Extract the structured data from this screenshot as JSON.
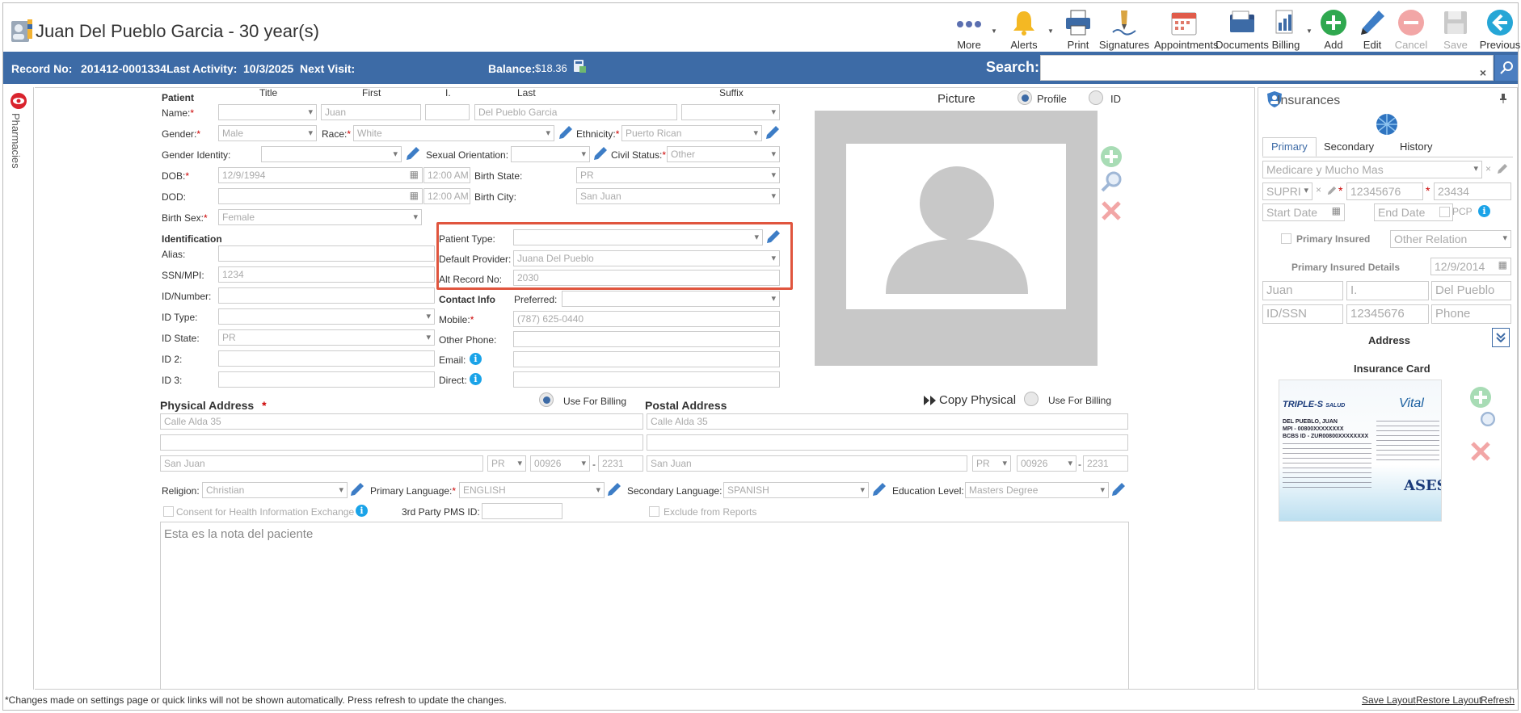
{
  "header": {
    "patient_title": "Juan Del Pueblo Garcia - 30 year(s)",
    "toolbar": {
      "more": "More",
      "alerts": "Alerts",
      "print": "Print",
      "signatures": "Signatures",
      "appointments": "Appointments",
      "documents": "Documents",
      "billing": "Billing",
      "add": "Add",
      "edit": "Edit",
      "cancel": "Cancel",
      "save": "Save",
      "previous": "Previous"
    }
  },
  "infobar": {
    "record_label": "Record No:",
    "record_value": "201412-0001334",
    "activity_label": "Last Activity:",
    "activity_value": "10/3/2025",
    "next_visit_label": "Next Visit:",
    "balance_label": "Balance:",
    "balance_value": "$18.36",
    "search_label": "Search:",
    "search_clear": "×"
  },
  "sidebar": {
    "pharmacies": "Pharmacies"
  },
  "patient": {
    "section": "Patient",
    "col_title": "Title",
    "col_first": "First",
    "col_initial": "I.",
    "col_last": "Last",
    "col_suffix": "Suffix",
    "name_label": "Name:",
    "first": "Juan",
    "last": "Del Pueblo Garcia",
    "gender_label": "Gender:",
    "gender": "Male",
    "race_label": "Race:",
    "race": "White",
    "ethnicity_label": "Ethnicity:",
    "ethnicity": "Puerto Rican",
    "gender_identity_label": "Gender Identity:",
    "sexual_orientation_label": "Sexual Orientation:",
    "civil_status_label": "Civil Status:",
    "civil_status": "Other",
    "dob_label": "DOB:",
    "dob": "12/9/1994",
    "dob_time": "12:00 AM",
    "birth_state_label": "Birth State:",
    "birth_state": "PR",
    "dod_label": "DOD:",
    "dod_time": "12:00 AM",
    "birth_city_label": "Birth City:",
    "birth_city": "San Juan",
    "birth_sex_label": "Birth Sex:",
    "birth_sex": "Female"
  },
  "identification": {
    "section": "Identification",
    "alias_label": "Alias:",
    "ssn_label": "SSN/MPI:",
    "ssn": "1234",
    "id_number_label": "ID/Number:",
    "id_type_label": "ID Type:",
    "id_state_label": "ID State:",
    "id_state": "PR",
    "id2_label": "ID 2:",
    "id3_label": "ID 3:"
  },
  "provider": {
    "patient_type_label": "Patient Type:",
    "default_provider_label": "Default Provider:",
    "default_provider": "Juana Del Pueblo",
    "alt_record_label": "Alt Record No:",
    "alt_record": "2030"
  },
  "contact": {
    "section": "Contact Info",
    "preferred_label": "Preferred:",
    "mobile_label": "Mobile:",
    "mobile": "(787) 625-0440",
    "other_phone_label": "Other Phone:",
    "email_label": "Email:",
    "direct_label": "Direct:"
  },
  "picture": {
    "title": "Picture",
    "profile": "Profile",
    "id": "ID"
  },
  "physical_address": {
    "title": "Physical Address",
    "use_for_billing": "Use For Billing",
    "line1": "Calle Alda 35",
    "city": "San Juan",
    "state": "PR",
    "zip": "00926",
    "zip4": "2231"
  },
  "postal_address": {
    "title": "Postal Address",
    "copy_physical": "Copy Physical",
    "use_for_billing": "Use For Billing",
    "line1": "Calle Alda 35",
    "city": "San Juan",
    "state": "PR",
    "zip": "00926",
    "zip4": "2231"
  },
  "other": {
    "religion_label": "Religion:",
    "religion": "Christian",
    "primary_language_label": "Primary Language:",
    "primary_language": "ENGLISH",
    "secondary_language_label": "Secondary Language:",
    "secondary_language": "SPANISH",
    "education_label": "Education Level:",
    "education": "Masters Degree",
    "consent_label": "Consent for Health Information Exchange",
    "third_party_label": "3rd Party PMS ID:",
    "exclude_label": "Exclude from Reports",
    "notes": "Esta es la nota del paciente"
  },
  "insurances": {
    "title": "Insurances",
    "tabs": [
      "Primary",
      "Secondary",
      "History"
    ],
    "plan": "Medicare y Mucho Mas",
    "relation_code": "SUPRI",
    "member_id": "12345676",
    "group": "23434",
    "start_date": "Start Date",
    "end_date": "End Date",
    "pcp": "PCP",
    "primary_insured": "Primary Insured",
    "other_relation": "Other Relation",
    "insured_details": "Primary Insured Details",
    "insured_dob": "12/9/2014",
    "insured_first": "Juan",
    "insured_initial": "I.",
    "insured_last": "Del Pueblo",
    "id_ssn": "ID/SSN",
    "insured_id": "12345676",
    "phone": "Phone",
    "address": "Address",
    "insurance_card": "Insurance Card"
  },
  "card": {
    "brand": "TRIPLE-S",
    "brand_sub": "SALUD",
    "vital": "Vital",
    "name": "DEL PUEBLO, JUAN",
    "mpi": "MPI - 00800XXXXXXXX",
    "bcbs": "BCBS ID - ZUR00800XXXXXXXX",
    "ases": "ASES"
  },
  "footer": {
    "note": "*Changes made on settings page or quick links will not be shown automatically. Press refresh to update the changes.",
    "save_layout": "Save Layout",
    "restore_layout": "Restore Layout",
    "refresh": "Refresh"
  },
  "colors": {
    "brand_blue": "#3d6ba6",
    "highlight_red": "#e0553e",
    "add_green": "#2fa84f",
    "cancel_red": "#e07070",
    "info_blue": "#1aa3e8"
  }
}
